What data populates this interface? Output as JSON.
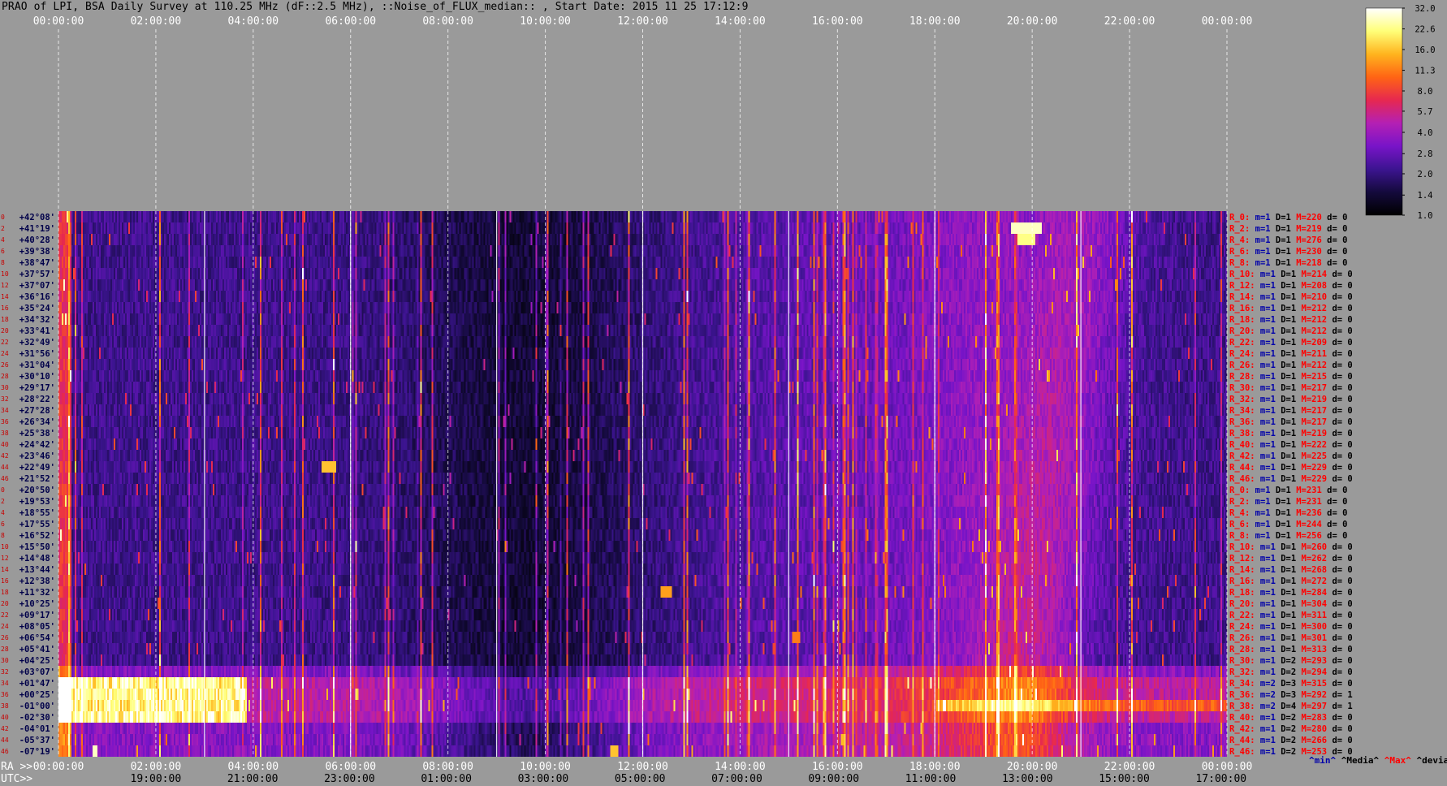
{
  "title": "PRAO of LPI, BSA Daily Survey at 110.25 MHz (dF::2.5 MHz), ::Noise_of_FLUX_median:: , Start Date: 2015 11 25 17:12:9",
  "chart_data": {
    "type": "heatmap",
    "title": "PRAO of LPI, BSA Daily Survey at 110.25 MHz (dF::2.5 MHz), ::Noise_of_FLUX_median:: , Start Date: 2015 11 25 17:12:9",
    "top_axis_ticks": [
      "00:00:00",
      "02:00:00",
      "04:00:00",
      "06:00:00",
      "08:00:00",
      "10:00:00",
      "12:00:00",
      "14:00:00",
      "16:00:00",
      "18:00:00",
      "20:00:00",
      "22:00:00",
      "00:00:00"
    ],
    "ra_axis_label": "RA >>",
    "ra_axis_ticks": [
      "00:00:00",
      "02:00:00",
      "04:00:00",
      "06:00:00",
      "08:00:00",
      "10:00:00",
      "12:00:00",
      "14:00:00",
      "16:00:00",
      "18:00:00",
      "20:00:00",
      "22:00:00",
      "00:00:00"
    ],
    "utc_axis_label": "UTC>>",
    "utc_axis_ticks": [
      "19:00:00",
      "21:00:00",
      "23:00:00",
      "01:00:00",
      "03:00:00",
      "05:00:00",
      "07:00:00",
      "09:00:00",
      "11:00:00",
      "13:00:00",
      "15:00:00",
      "17:00:00"
    ],
    "declinations": [
      "+42°08'",
      "+41°19'",
      "+40°28'",
      "+39°38'",
      "+38°47'",
      "+37°57'",
      "+37°07'",
      "+36°16'",
      "+35°24'",
      "+34°32'",
      "+33°41'",
      "+32°49'",
      "+31°56'",
      "+31°04'",
      "+30°10'",
      "+29°17'",
      "+28°22'",
      "+27°28'",
      "+26°34'",
      "+25°38'",
      "+24°42'",
      "+23°46'",
      "+22°49'",
      "+21°52'",
      "+20°50'",
      "+19°53'",
      "+18°55'",
      "+17°55'",
      "+16°52'",
      "+15°50'",
      "+14°48'",
      "+13°44'",
      "+12°38'",
      "+11°32'",
      "+10°25'",
      "+09°17'",
      "+08°05'",
      "+06°54'",
      "+05°41'",
      "+04°25'",
      "+03°07'",
      "+01°47'",
      "+00°25'",
      "-01°00'",
      "-02°30'",
      "-04°01'",
      "-05°37'",
      "-07°19'"
    ],
    "colorbar_ticks": [
      "32.0",
      "22.6",
      "16.0",
      "11.3",
      "8.0",
      "5.7",
      "4.0",
      "2.8",
      "2.0",
      "1.4",
      "1.0"
    ],
    "colorbar_range": [
      1.0,
      32.0
    ],
    "colorbar_scale": "log",
    "colormap": [
      "#000000",
      "#140a3c",
      "#3c1490",
      "#7814c8",
      "#b420b4",
      "#e62850",
      "#ff6414",
      "#ffb41e",
      "#ffff78",
      "#ffffff"
    ],
    "row_stats": [
      {
        "r": "R_0:",
        "m": "m=1",
        "D": "D=1",
        "M": "M=220",
        "d": "d= 0"
      },
      {
        "r": "R_2:",
        "m": "m=1",
        "D": "D=1",
        "M": "M=219",
        "d": "d= 0"
      },
      {
        "r": "R_4:",
        "m": "m=1",
        "D": "D=1",
        "M": "M=276",
        "d": "d= 0"
      },
      {
        "r": "R_6:",
        "m": "m=1",
        "D": "D=1",
        "M": "M=230",
        "d": "d= 0"
      },
      {
        "r": "R_8:",
        "m": "m=1",
        "D": "D=1",
        "M": "M=218",
        "d": "d= 0"
      },
      {
        "r": "R_10:",
        "m": "m=1",
        "D": "D=1",
        "M": "M=214",
        "d": "d= 0"
      },
      {
        "r": "R_12:",
        "m": "m=1",
        "D": "D=1",
        "M": "M=208",
        "d": "d= 0"
      },
      {
        "r": "R_14:",
        "m": "m=1",
        "D": "D=1",
        "M": "M=210",
        "d": "d= 0"
      },
      {
        "r": "R_16:",
        "m": "m=1",
        "D": "D=1",
        "M": "M=212",
        "d": "d= 0"
      },
      {
        "r": "R_18:",
        "m": "m=1",
        "D": "D=1",
        "M": "M=212",
        "d": "d= 0"
      },
      {
        "r": "R_20:",
        "m": "m=1",
        "D": "D=1",
        "M": "M=212",
        "d": "d= 0"
      },
      {
        "r": "R_22:",
        "m": "m=1",
        "D": "D=1",
        "M": "M=209",
        "d": "d= 0"
      },
      {
        "r": "R_24:",
        "m": "m=1",
        "D": "D=1",
        "M": "M=211",
        "d": "d= 0"
      },
      {
        "r": "R_26:",
        "m": "m=1",
        "D": "D=1",
        "M": "M=212",
        "d": "d= 0"
      },
      {
        "r": "R_28:",
        "m": "m=1",
        "D": "D=1",
        "M": "M=215",
        "d": "d= 0"
      },
      {
        "r": "R_30:",
        "m": "m=1",
        "D": "D=1",
        "M": "M=217",
        "d": "d= 0"
      },
      {
        "r": "R_32:",
        "m": "m=1",
        "D": "D=1",
        "M": "M=219",
        "d": "d= 0"
      },
      {
        "r": "R_34:",
        "m": "m=1",
        "D": "D=1",
        "M": "M=217",
        "d": "d= 0"
      },
      {
        "r": "R_36:",
        "m": "m=1",
        "D": "D=1",
        "M": "M=217",
        "d": "d= 0"
      },
      {
        "r": "R_38:",
        "m": "m=1",
        "D": "D=1",
        "M": "M=219",
        "d": "d= 0"
      },
      {
        "r": "R_40:",
        "m": "m=1",
        "D": "D=1",
        "M": "M=222",
        "d": "d= 0"
      },
      {
        "r": "R_42:",
        "m": "m=1",
        "D": "D=1",
        "M": "M=225",
        "d": "d= 0"
      },
      {
        "r": "R_44:",
        "m": "m=1",
        "D": "D=1",
        "M": "M=229",
        "d": "d= 0"
      },
      {
        "r": "R_46:",
        "m": "m=1",
        "D": "D=1",
        "M": "M=229",
        "d": "d= 0"
      },
      {
        "r": "R_0:",
        "m": "m=1",
        "D": "D=1",
        "M": "M=231",
        "d": "d= 0"
      },
      {
        "r": "R_2:",
        "m": "m=1",
        "D": "D=1",
        "M": "M=231",
        "d": "d= 0"
      },
      {
        "r": "R_4:",
        "m": "m=1",
        "D": "D=1",
        "M": "M=236",
        "d": "d= 0"
      },
      {
        "r": "R_6:",
        "m": "m=1",
        "D": "D=1",
        "M": "M=244",
        "d": "d= 0"
      },
      {
        "r": "R_8:",
        "m": "m=1",
        "D": "D=1",
        "M": "M=256",
        "d": "d= 0"
      },
      {
        "r": "R_10:",
        "m": "m=1",
        "D": "D=1",
        "M": "M=260",
        "d": "d= 0"
      },
      {
        "r": "R_12:",
        "m": "m=1",
        "D": "D=1",
        "M": "M=262",
        "d": "d= 0"
      },
      {
        "r": "R_14:",
        "m": "m=1",
        "D": "D=1",
        "M": "M=268",
        "d": "d= 0"
      },
      {
        "r": "R_16:",
        "m": "m=1",
        "D": "D=1",
        "M": "M=272",
        "d": "d= 0"
      },
      {
        "r": "R_18:",
        "m": "m=1",
        "D": "D=1",
        "M": "M=284",
        "d": "d= 0"
      },
      {
        "r": "R_20:",
        "m": "m=1",
        "D": "D=1",
        "M": "M=304",
        "d": "d= 0"
      },
      {
        "r": "R_22:",
        "m": "m=1",
        "D": "D=1",
        "M": "M=311",
        "d": "d= 0"
      },
      {
        "r": "R_24:",
        "m": "m=1",
        "D": "D=1",
        "M": "M=300",
        "d": "d= 0"
      },
      {
        "r": "R_26:",
        "m": "m=1",
        "D": "D=1",
        "M": "M=301",
        "d": "d= 0"
      },
      {
        "r": "R_28:",
        "m": "m=1",
        "D": "D=1",
        "M": "M=313",
        "d": "d= 0"
      },
      {
        "r": "R_30:",
        "m": "m=1",
        "D": "D=2",
        "M": "M=293",
        "d": "d= 0"
      },
      {
        "r": "R_32:",
        "m": "m=1",
        "D": "D=2",
        "M": "M=294",
        "d": "d= 0"
      },
      {
        "r": "R_34:",
        "m": "m=2",
        "D": "D=3",
        "M": "M=315",
        "d": "d= 0"
      },
      {
        "r": "R_36:",
        "m": "m=2",
        "D": "D=3",
        "M": "M=292",
        "d": "d= 1"
      },
      {
        "r": "R_38:",
        "m": "m=2",
        "D": "D=4",
        "M": "M=297",
        "d": "d= 1"
      },
      {
        "r": "R_40:",
        "m": "m=1",
        "D": "D=2",
        "M": "M=283",
        "d": "d= 0"
      },
      {
        "r": "R_42:",
        "m": "m=1",
        "D": "D=2",
        "M": "M=280",
        "d": "d= 0"
      },
      {
        "r": "R_44:",
        "m": "m=1",
        "D": "D=2",
        "M": "M=266",
        "d": "d= 0"
      },
      {
        "r": "R_46:",
        "m": "m=1",
        "D": "D=2",
        "M": "M=253",
        "d": "d= 0"
      }
    ],
    "row_stat_colors": {
      "r": "#ff0000",
      "m": "#0000aa",
      "D": "#000000",
      "M": "#ff0000",
      "d": "#000000"
    },
    "stat_legend": {
      "min": "^min^",
      "median": "^Media^",
      "max": "^Max^",
      "dev": "^devia^"
    },
    "stat_legend_colors": {
      "min": "#0000aa",
      "median": "#000000",
      "max": "#ff0000",
      "dev": "#000000"
    },
    "beam_numbers": [
      "0",
      "2",
      "4",
      "6",
      "8",
      "10",
      "12",
      "14",
      "16",
      "18",
      "20",
      "22",
      "24",
      "26",
      "28",
      "30",
      "32",
      "34",
      "36",
      "38",
      "40",
      "42",
      "44",
      "46",
      "0",
      "2",
      "4",
      "6",
      "8",
      "10",
      "12",
      "14",
      "16",
      "18",
      "20",
      "22",
      "24",
      "26",
      "28",
      "30",
      "32",
      "34",
      "36",
      "38",
      "40",
      "42",
      "44",
      "46"
    ],
    "colors": {
      "background": "#9a9a9a",
      "dec_label": "#00004a",
      "beam_label": "#c80000",
      "tick_text": "#ffffff",
      "axis_label": "#000000"
    }
  }
}
